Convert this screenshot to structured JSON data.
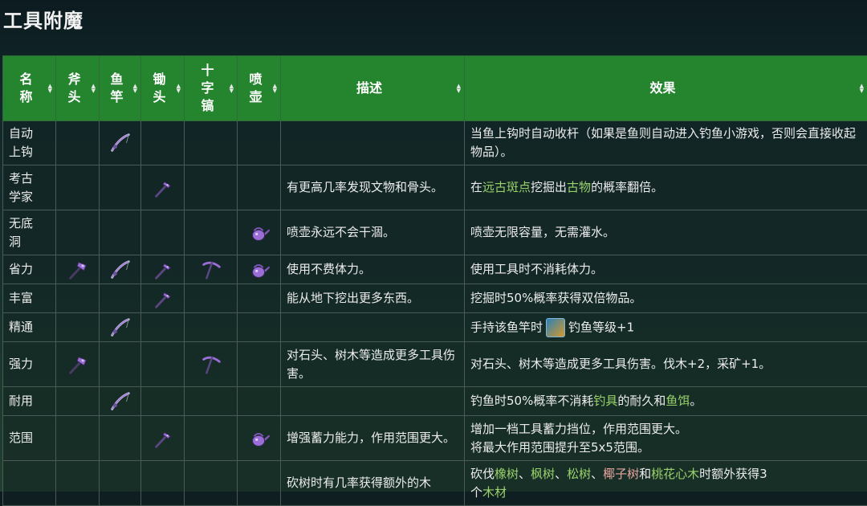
{
  "page": {
    "title": "工具附魔"
  },
  "table": {
    "headers": {
      "name": "名\n称",
      "axe": "斧\n头",
      "rod": "鱼\n竿",
      "hoe": "锄\n头",
      "pickaxe": "十\n字\n镐",
      "can": "喷\n壶",
      "desc": "描述",
      "effect": "效果"
    },
    "sort_symbol": "▲▼",
    "rows": [
      {
        "name": "自动\n上钩",
        "desc": "",
        "effect": [
          {
            "t": "当鱼上钩时自动收杆（如果是鱼则自动进入钓鱼小游戏，否则会直接收起物品）。"
          }
        ]
      },
      {
        "name": "考古\n学家",
        "desc": "有更高几率发现文物和骨头。",
        "effect": [
          {
            "t": "在"
          },
          {
            "t": "远古斑点",
            "hl": true
          },
          {
            "t": "挖掘出"
          },
          {
            "t": "古物",
            "hl": true
          },
          {
            "t": "的概率翻倍。"
          }
        ]
      },
      {
        "name": "无底\n洞",
        "desc": "喷壶永远不会干涸。",
        "effect": [
          {
            "t": "喷壶无限容量，无需灌水。"
          }
        ]
      },
      {
        "name": "省力",
        "desc": "使用不费体力。",
        "effect": [
          {
            "t": "使用工具时不消耗体力。"
          }
        ]
      },
      {
        "name": "丰富",
        "desc": "能从地下挖出更多东西。",
        "effect": [
          {
            "t": "挖掘时50%概率获得双倍物品。"
          }
        ]
      },
      {
        "name": "精通",
        "desc": "",
        "effect": [
          {
            "t": "手持该鱼竿时"
          },
          {
            "badge": true
          },
          {
            "t": "钓鱼等级+1"
          }
        ]
      },
      {
        "name": "强力",
        "desc": "对石头、树木等造成更多工具伤害。",
        "effect": [
          {
            "t": "对石头、树木等造成更多工具伤害。伐木+2，采矿+1。"
          }
        ]
      },
      {
        "name": "耐用",
        "desc": "",
        "effect": [
          {
            "t": "钓鱼时50%概率不消耗"
          },
          {
            "t": "钓具",
            "hl": true
          },
          {
            "t": "的耐久和"
          },
          {
            "t": "鱼饵",
            "hl": true
          },
          {
            "t": "。"
          }
        ]
      },
      {
        "name": "范围",
        "desc": "增强蓄力能力，作用范围更大。",
        "effect": [
          {
            "t": "增加一档工具蓄力挡位，作用范围更大。\n将最大作用范围提升至5x5范围。"
          }
        ]
      },
      {
        "name": "",
        "desc": "砍树时有几率获得额外的木",
        "effect": [
          {
            "t": "砍伐"
          },
          {
            "t": "橡树",
            "hl": true
          },
          {
            "t": "、"
          },
          {
            "t": "枫树",
            "hl": true
          },
          {
            "t": "、"
          },
          {
            "t": "松树",
            "hl": true
          },
          {
            "t": "、"
          },
          {
            "t": "椰子树",
            "hl": "pink"
          },
          {
            "t": "和"
          },
          {
            "t": "桃花心木",
            "hl": true
          },
          {
            "t": "时额外获得3\n个"
          },
          {
            "t": "木材",
            "hl": true
          }
        ]
      }
    ]
  },
  "icon_map": [
    {
      "rod": true
    },
    {
      "hoe": true
    },
    {
      "can": true
    },
    {
      "axe": true,
      "rod": true,
      "hoe": true,
      "pickaxe": true,
      "can": true
    },
    {
      "hoe": true
    },
    {
      "rod": true
    },
    {
      "axe": true,
      "pickaxe": true
    },
    {
      "rod": true
    },
    {
      "hoe": true,
      "can": true
    },
    {}
  ],
  "icons": {
    "axe": "axe-icon",
    "rod": "fishing-rod-icon",
    "hoe": "hoe-icon",
    "pickaxe": "pickaxe-icon",
    "can": "watering-can-icon"
  },
  "colors": {
    "header_bg": "#24852e",
    "highlight": "#9ad26a",
    "highlight_pink": "#e9a6a0",
    "icon_purple": "#9b6dd6"
  }
}
